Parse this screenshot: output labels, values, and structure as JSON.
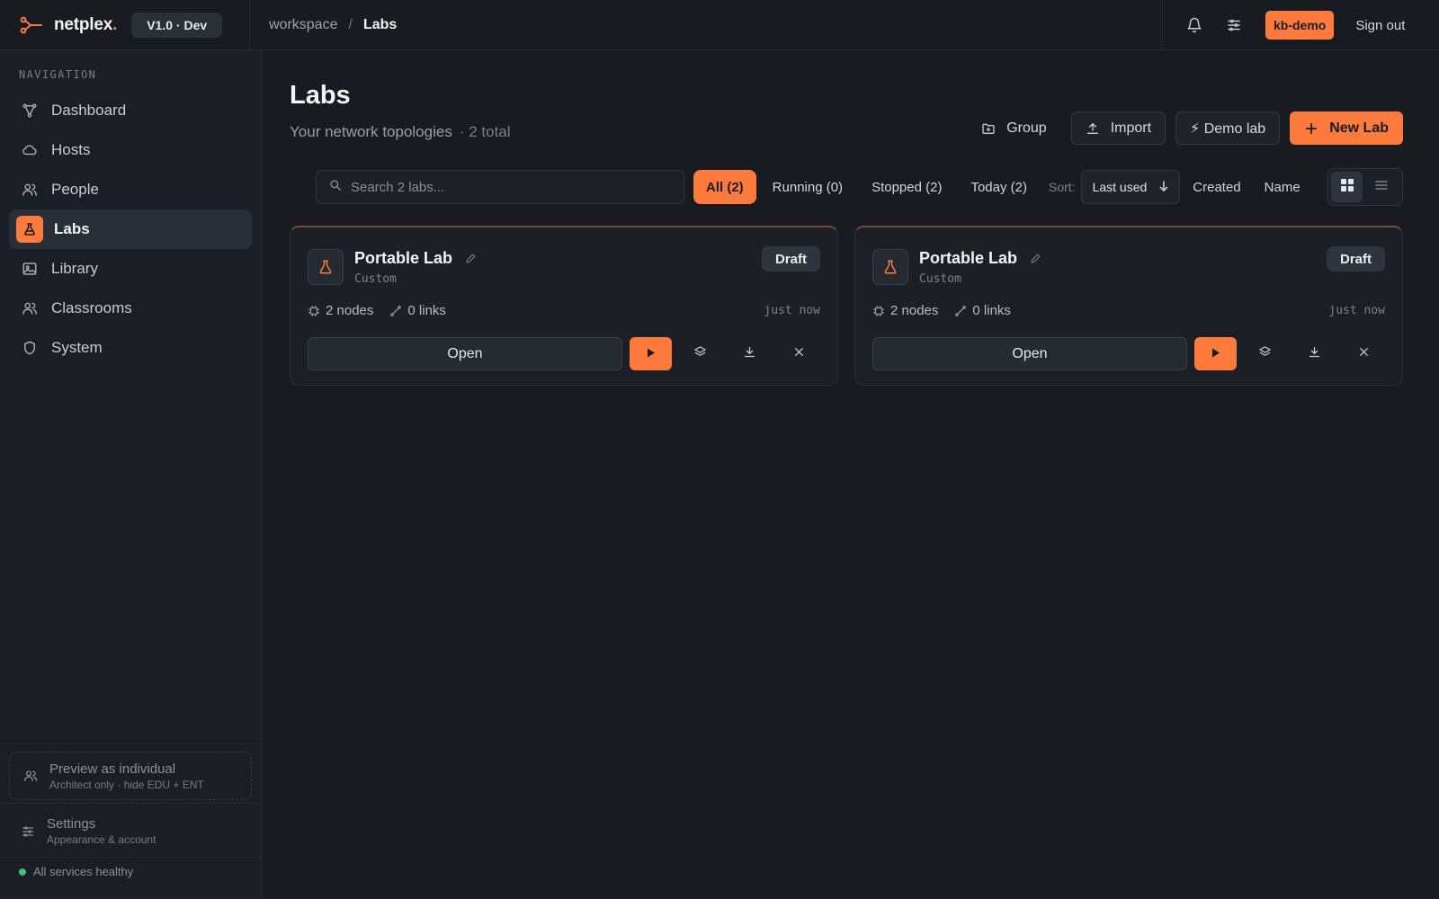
{
  "app": {
    "brand_name": "netplex",
    "brand_dot": ".",
    "version": "V1.0 · Dev",
    "accent_color": "#ff7a3d"
  },
  "breadcrumb": {
    "root": "workspace",
    "separator": "/",
    "current": "Labs"
  },
  "topbar": {
    "user": "kb-demo",
    "sign_out": "Sign out",
    "icons": [
      "bell-icon",
      "sliders-icon"
    ]
  },
  "sidebar": {
    "title": "NAVIGATION",
    "items": [
      {
        "label": "Dashboard",
        "icon": "topology-icon",
        "active": false
      },
      {
        "label": "Hosts",
        "icon": "cloud-icon",
        "active": false
      },
      {
        "label": "People",
        "icon": "users-icon",
        "active": false
      },
      {
        "label": "Labs",
        "icon": "flask-icon",
        "active": true
      },
      {
        "label": "Library",
        "icon": "image-icon",
        "active": false
      },
      {
        "label": "Classrooms",
        "icon": "users-icon",
        "active": false
      },
      {
        "label": "System",
        "icon": "shield-icon",
        "active": false
      }
    ],
    "preview": {
      "title": "Preview as individual",
      "subtitle": "Architect only · hide EDU + ENT"
    },
    "settings": {
      "title": "Settings",
      "subtitle": "Appearance & account"
    },
    "health": {
      "text": "All services healthy",
      "color": "#3ec46d"
    }
  },
  "page": {
    "title": "Labs",
    "subtitle": "Your network topologies",
    "count": "· 2 total"
  },
  "actions": {
    "group": "Group",
    "import": "Import",
    "demo_lab": "⚡ Demo lab",
    "new_lab": "New Lab"
  },
  "toolbar": {
    "search_placeholder": "Search 2 labs...",
    "filters": [
      {
        "label": "All (2)",
        "active": true
      },
      {
        "label": "Running (0)",
        "active": false
      },
      {
        "label": "Stopped (2)",
        "active": false
      },
      {
        "label": "Today (2)",
        "active": false
      }
    ],
    "sort_label": "Sort:",
    "sort_selected": "Last used",
    "sort_options": [
      "Created",
      "Name"
    ],
    "view_modes": [
      "grid-icon",
      "list-icon"
    ],
    "active_view": "grid"
  },
  "labs": [
    {
      "name": "Portable Lab",
      "type": "Custom",
      "status": "Draft",
      "nodes_count": "2",
      "nodes_label": "nodes",
      "links_count": "0",
      "links_label": "links",
      "time": "just now",
      "open_label": "Open"
    },
    {
      "name": "Portable Lab",
      "type": "Custom",
      "status": "Draft",
      "nodes_count": "2",
      "nodes_label": "nodes",
      "links_count": "0",
      "links_label": "links",
      "time": "just now",
      "open_label": "Open"
    }
  ]
}
